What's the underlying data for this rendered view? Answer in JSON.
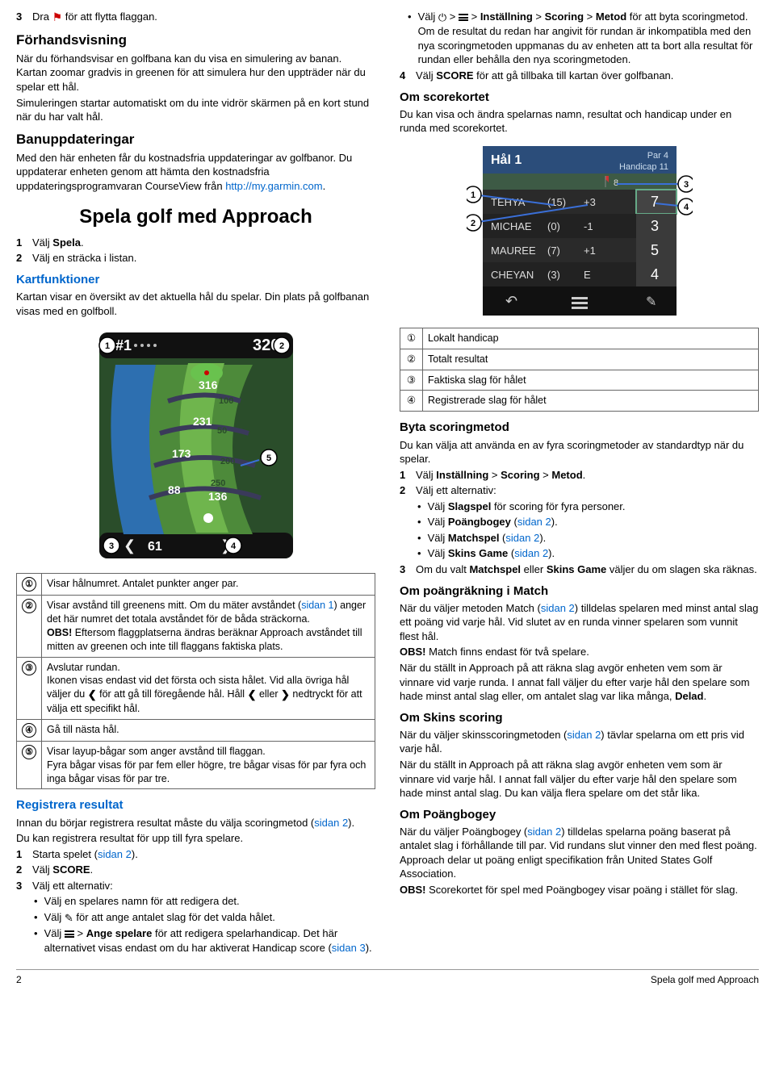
{
  "left": {
    "step3": {
      "num": "3",
      "pre": "Dra ",
      "post": " för att flytta flaggan."
    },
    "preview_h": "Förhandsvisning",
    "preview_p1": "När du förhandsvisar en golfbana kan du visa en simulering av banan. Kartan zoomar gradvis in greenen för att simulera hur den uppträder när du spelar ett hål.",
    "preview_p2": "Simuleringen startar automatiskt om du inte vidrör skärmen på en kort stund när du har valt hål.",
    "updates_h": "Banuppdateringar",
    "updates_p_a": "Med den här enheten får du kostnadsfria uppdateringar av golfbanor. Du uppdaterar enheten genom att hämta den kostnadsfria uppdateringsprogramvaran CourseView från ",
    "updates_link": "http://my.garmin.com",
    "updates_p_b": ".",
    "play_h": "Spela golf med Approach",
    "play_s1": {
      "num": "1",
      "a": "Välj ",
      "b": "Spela",
      "c": "."
    },
    "play_s2": {
      "num": "2",
      "text": "Välj en sträcka i listan."
    },
    "map_h": "Kartfunktioner",
    "map_p": "Kartan visar en översikt av det aktuella hål du spelar. Din plats på golfbanan visas med en golfboll.",
    "map_vals": {
      "hole": "#1",
      "dist": "320",
      "a": "316",
      "b": "231",
      "c": "173",
      "d": "88",
      "e": "136",
      "f": "61",
      "g": "50",
      "h": "200",
      "i": "250",
      "j": "100"
    },
    "leg1": "Visar hålnumret. Antalet punkter anger par.",
    "leg2a": "Visar avstånd till greenens mitt. Om du mäter avståndet (",
    "leg2link": "sidan 1",
    "leg2b": ") anger det här numret det totala avståndet för de båda sträckorna.",
    "leg2obs": "OBS!",
    "leg2c": " Eftersom flaggplatserna ändras beräknar Approach avståndet till mitten av greenen och inte till flaggans faktiska plats.",
    "leg3a": "Avslutar rundan.",
    "leg3b": "Ikonen visas endast vid det första och sista hålet. Vid alla övriga hål väljer du ",
    "leg3c": " för att gå till föregående hål. Håll ",
    "leg3d": " eller ",
    "leg3e": " nedtryckt för att välja ett specifikt hål.",
    "leg4": "Gå till nästa hål.",
    "leg5a": "Visar layup-bågar som anger avstånd till flaggan.",
    "leg5b": "Fyra bågar visas för par fem eller högre, tre bågar visas för par fyra och inga bågar visas för par tre.",
    "reg_h": "Registrera resultat",
    "reg_p1a": "Innan du börjar registrera resultat måste du välja scoringmetod (",
    "reg_link1": "sidan 2",
    "reg_p1b": ").",
    "reg_p2": "Du kan registrera resultat för upp till fyra spelare.",
    "reg_s1": {
      "num": "1",
      "a": "Starta spelet (",
      "link": "sidan 2",
      "b": ")."
    },
    "reg_s2": {
      "num": "2",
      "a": "Välj ",
      "b": "SCORE",
      "c": "."
    },
    "reg_s3": {
      "num": "3",
      "text": "Välj ett alternativ:"
    },
    "reg_b1": "Välj en spelares namn för att redigera det.",
    "reg_b2a": "Välj ",
    "reg_b2b": " för att ange antalet slag för det valda hålet.",
    "reg_b3a": "Välj ",
    "reg_b3b": " > ",
    "reg_b3c": "Ange spelare",
    "reg_b3d": " för att redigera spelarhandicap. Det här alternativet visas endast om du har aktiverat Handicap score (",
    "reg_b3link": "sidan 3",
    "reg_b3e": ")."
  },
  "right": {
    "top_b_a": "Välj ",
    "top_b_b": " > ",
    "top_b_c": " > ",
    "top_b_d": "Inställning",
    "top_b_e": " > ",
    "top_b_f": "Scoring",
    "top_b_g": " > ",
    "top_b_h": "Metod",
    "top_b_i": " för att byta scoringmetod. Om de resultat du redan har angivit för rundan är inkompatibla med den nya scoringmetoden uppmanas du av enheten att ta bort alla resultat för rundan eller behålla den nya scoringmetoden.",
    "top_s4": {
      "num": "4",
      "a": "Välj ",
      "b": "SCORE",
      "c": " för att gå tillbaka till kartan över golfbanan."
    },
    "score_h": "Om scorekortet",
    "score_p": "Du kan visa och ändra spelarnas namn, resultat och handicap under en runda med scorekortet.",
    "card": {
      "hole": "Hål 1",
      "par": "Par 4",
      "hcap": "Handicap 11",
      "rows": [
        {
          "name": "TEHYA",
          "h": "(15)",
          "d": "+3",
          "s": "7"
        },
        {
          "name": "MICHAE",
          "h": "(0)",
          "d": "-1",
          "s": "3"
        },
        {
          "name": "MAUREE",
          "h": "(7)",
          "d": "+1",
          "s": "5"
        },
        {
          "name": "CHEYAN",
          "h": "(3)",
          "d": "E",
          "s": "4"
        }
      ],
      "flag8": "8"
    },
    "tleg": [
      {
        "n": "①",
        "t": "Lokalt handicap"
      },
      {
        "n": "②",
        "t": "Totalt resultat"
      },
      {
        "n": "③",
        "t": "Faktiska slag för hålet"
      },
      {
        "n": "④",
        "t": "Registrerade slag för hålet"
      }
    ],
    "chg_h": "Byta scoringmetod",
    "chg_p": "Du kan välja att använda en av fyra scoringmetoder av standardtyp när du spelar.",
    "chg_s1": {
      "num": "1",
      "a": "Välj ",
      "b": "Inställning",
      "c": " > ",
      "d": "Scoring",
      "e": " > ",
      "f": "Metod",
      "g": "."
    },
    "chg_s2": {
      "num": "2",
      "text": "Välj ett alternativ:"
    },
    "chg_b1": {
      "a": "Välj ",
      "b": "Slagspel",
      "c": " för scoring för fyra personer."
    },
    "chg_b2": {
      "a": "Välj ",
      "b": "Poängbogey",
      "c": " (",
      "link": "sidan 2",
      "d": ")."
    },
    "chg_b3": {
      "a": "Välj ",
      "b": "Matchspel",
      "c": " (",
      "link": "sidan 2",
      "d": ")."
    },
    "chg_b4": {
      "a": "Välj ",
      "b": "Skins Game",
      "c": " (",
      "link": "sidan 2",
      "d": ")."
    },
    "chg_s3": {
      "num": "3",
      "a": "Om du valt ",
      "b": "Matchspel",
      "c": " eller ",
      "d": "Skins Game",
      "e": " väljer du om slagen ska räknas."
    },
    "match_h": "Om poängräkning i Match",
    "match_p1a": "När du väljer metoden Match (",
    "match_link": "sidan 2",
    "match_p1b": ") tilldelas spelaren med minst antal slag ett poäng vid varje hål. Vid slutet av en runda vinner spelaren som vunnit flest hål.",
    "match_obs": "OBS!",
    "match_p2": " Match finns endast för två spelare.",
    "match_p3": "När du ställt in Approach på att räkna slag avgör enheten vem som är vinnare vid varje runda. I annat fall väljer du efter varje hål den spelare som hade minst antal slag eller, om antalet slag var lika många, ",
    "match_p3b": "Delad",
    "match_p3c": ".",
    "skins_h": "Om Skins scoring",
    "skins_p1a": "När du väljer skinsscoringmetoden (",
    "skins_link": "sidan 2",
    "skins_p1b": ") tävlar spelarna om ett pris vid varje hål.",
    "skins_p2": "När du ställt in Approach på att räkna slag avgör enheten vem som är vinnare vid varje hål. I annat fall väljer du efter varje hål den spelare som hade minst antal slag. Du kan välja flera spelare om det står lika.",
    "pb_h": "Om Poängbogey",
    "pb_p1a": "När du väljer Poängbogey (",
    "pb_link": "sidan 2",
    "pb_p1b": ") tilldelas spelarna poäng baserat på antalet slag i förhållande till par. Vid rundans slut vinner den med flest poäng. Approach delar ut poäng enligt specifikation från United States Golf Association.",
    "pb_obs": "OBS!",
    "pb_p2": " Scorekortet för spel med Poängbogey visar poäng i stället för slag."
  },
  "footer": {
    "left": "2",
    "right": "Spela golf med Approach"
  }
}
